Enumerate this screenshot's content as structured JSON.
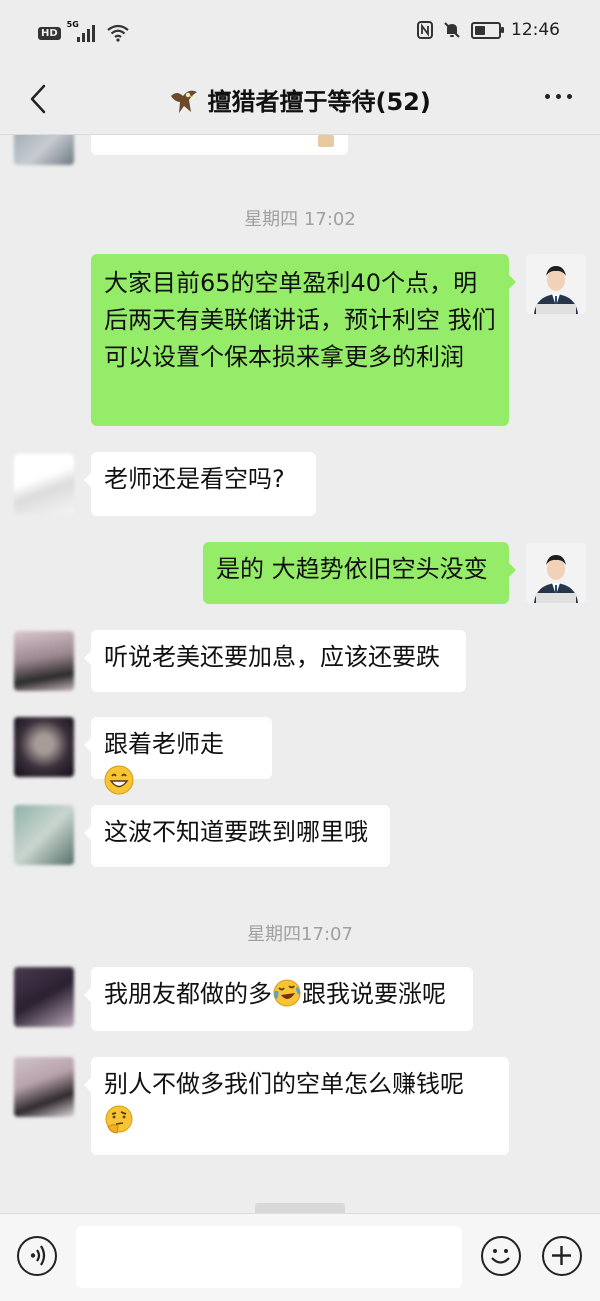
{
  "status_bar": {
    "left_badge": "HD",
    "network": "5G",
    "icons": [
      "signal-icon",
      "wifi-icon",
      "nfc-icon",
      "mute-icon",
      "battery-icon"
    ],
    "battery_level": 0.55,
    "time": "12:46"
  },
  "header": {
    "title": "擅猎者擅于等待(52)",
    "title_emoji": "eagle-icon",
    "back_icon": "chevron-left-icon",
    "more_icon": "more-dots-icon"
  },
  "messages": [
    {
      "type": "time",
      "text": "星期四 17:02"
    },
    {
      "type": "out",
      "text": "大家目前65的空单盈利40个点，明后两天有美联储讲话，预计利空 我们可以设置个保本损来拿更多的利润"
    },
    {
      "type": "in",
      "text": "老师还是看空吗?"
    },
    {
      "type": "out",
      "text": "是的 大趋势依旧空头没变"
    },
    {
      "type": "in",
      "text": "听说老美还要加息，应该还要跌"
    },
    {
      "type": "in",
      "text": "跟着老师走",
      "emoji": "grinning-emoji"
    },
    {
      "type": "in",
      "text": "这波不知道要跌到哪里哦"
    },
    {
      "type": "time",
      "text": "星期四17:07"
    },
    {
      "type": "in",
      "text_a": "我朋友都做的多",
      "emoji": "crying-laughing-emoji",
      "text_b": "跟我说要涨呢"
    },
    {
      "type": "in",
      "text": "别人不做多我们的空单怎么赚钱呢",
      "emoji": "thinking-emoji"
    }
  ],
  "input_bar": {
    "voice_icon": "voice-icon",
    "emoji_icon": "smiley-icon",
    "plus_icon": "plus-icon"
  },
  "colors": {
    "background": "#ededed",
    "bubble_out": "#95ec69",
    "bubble_in": "#ffffff",
    "time_text": "#a0a0a0"
  }
}
